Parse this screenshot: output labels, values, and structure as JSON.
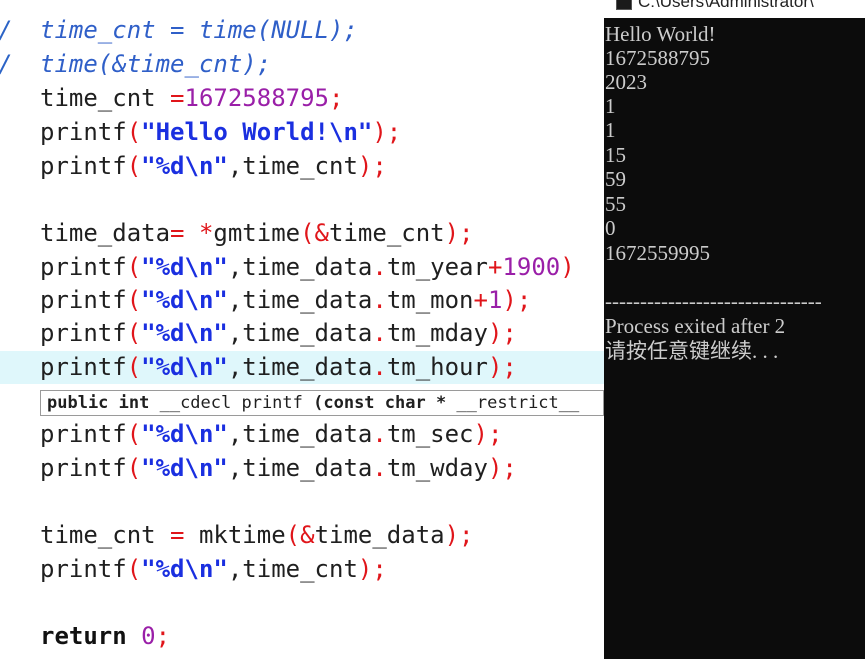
{
  "editor": {
    "lines": [
      {
        "gutter": "/",
        "comment": "time_cnt = time(NULL);"
      },
      {
        "gutter": "/",
        "comment": "time(&time_cnt);"
      },
      {
        "a": "time_cnt ",
        "p1": "=",
        "n1": "1672588795",
        "p2": ";"
      },
      {
        "a": "printf",
        "p1": "(",
        "s1": "\"Hello World!\\n\"",
        "p2": ");"
      },
      {
        "a": "printf",
        "p1": "(",
        "s1": "\"%d\\n\"",
        "b": ",time_cnt",
        "p2": ");"
      },
      {
        "a": "time_data",
        "p1": "= *",
        "b": "gmtime",
        "p2": "(&",
        "c": "time_cnt",
        "p3": ");"
      },
      {
        "a": "printf",
        "p1": "(",
        "s1": "\"%d\\n\"",
        "b": ",time_data",
        "p2": ".",
        "c": "tm_year",
        "p3": "+",
        "n1": "1900",
        "p4": ")"
      },
      {
        "a": "printf",
        "p1": "(",
        "s1": "\"%d\\n\"",
        "b": ",time_data",
        "p2": ".",
        "c": "tm_mon",
        "p3": "+",
        "n1": "1",
        "p4": ");"
      },
      {
        "a": "printf",
        "p1": "(",
        "s1": "\"%d\\n\"",
        "b": ",time_data",
        "p2": ".",
        "c": "tm_mday",
        "p3": ");"
      },
      {
        "a": "printf",
        "p1": "(",
        "s1": "\"%d\\n\"",
        "b": ",time_data",
        "p2": ".",
        "c": "tm_hour",
        "p3": ");"
      },
      {
        "a": "printf",
        "p1": "(",
        "s1": "\"%d\\n\"",
        "b": ",time_data",
        "p2": ".",
        "c": "tm_sec",
        "p3": ");"
      },
      {
        "a": "printf",
        "p1": "(",
        "s1": "\"%d\\n\"",
        "b": ",time_data",
        "p2": ".",
        "c": "tm_wday",
        "p3": ");"
      },
      {
        "a": "time_cnt ",
        "p1": "=",
        "b": " mktime",
        "p2": "(&",
        "c": "time_data",
        "p3": ");"
      },
      {
        "a": "printf",
        "p1": "(",
        "s1": "\"%d\\n\"",
        "b": ",time_cnt",
        "p2": ");"
      },
      {
        "k": "return",
        "n1": " 0",
        "p1": ";"
      }
    ],
    "tooltip": {
      "bold1": "public int ",
      "normal1": "__cdecl printf ",
      "bold2": "(const char * ",
      "normal2": "__restrict__"
    }
  },
  "console": {
    "title": "C:\\Users\\Administrator\\",
    "output": [
      "Hello World!",
      "1672588795",
      "2023",
      "1",
      "1",
      "15",
      "59",
      "55",
      "0",
      "1672559995"
    ],
    "separator": "-------------------------------",
    "process_line": "Process exited after 2",
    "prompt": "请按任意键继续. . ."
  }
}
